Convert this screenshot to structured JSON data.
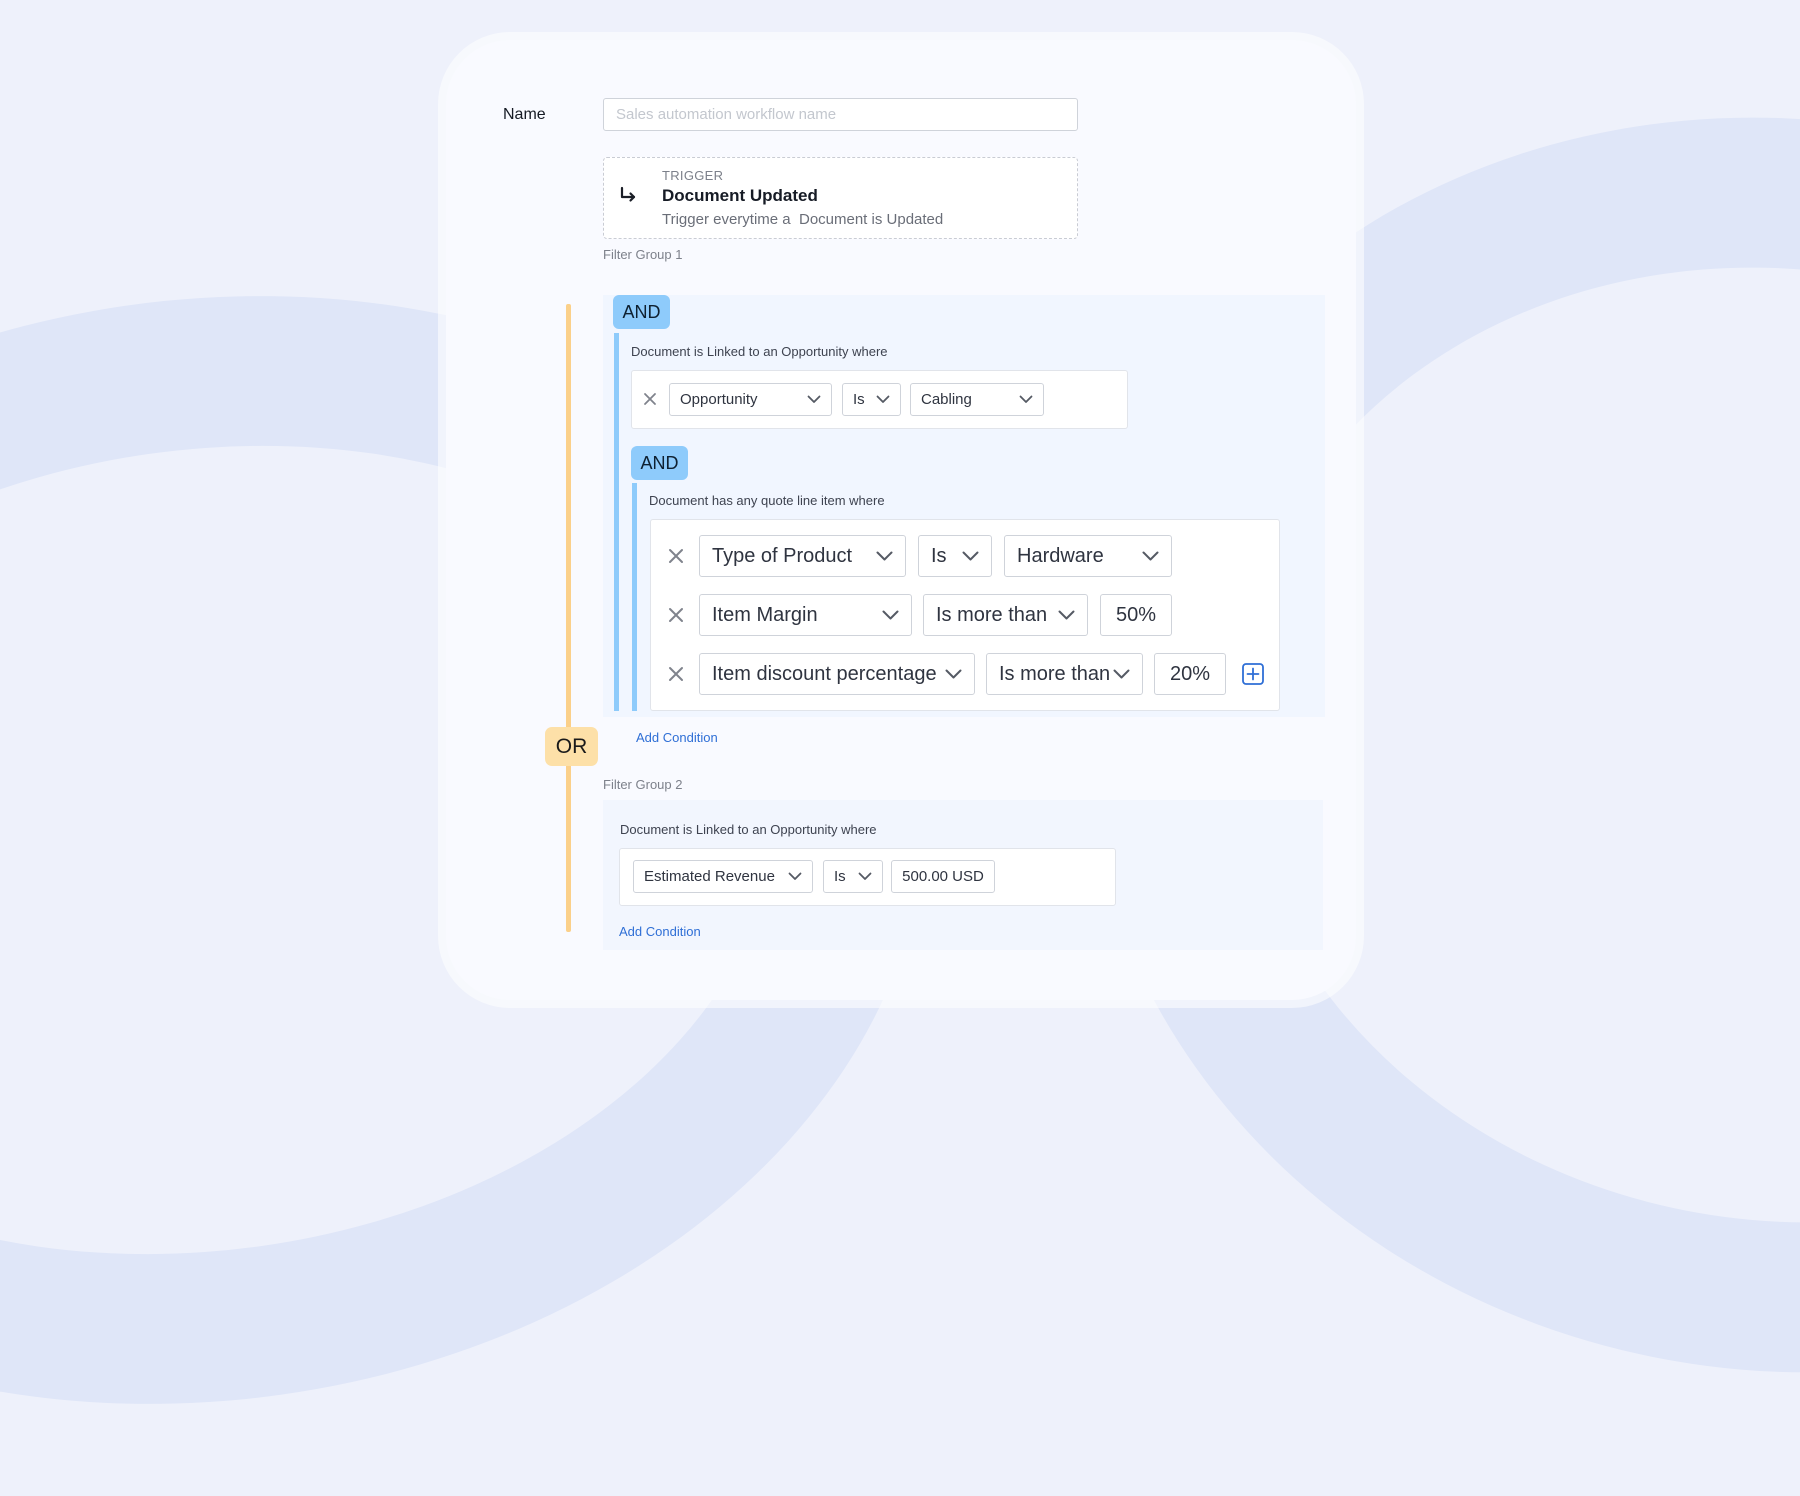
{
  "form": {
    "name_label": "Name",
    "name_placeholder": "Sales automation workflow name",
    "name_value": ""
  },
  "trigger": {
    "icon": "arrow-turn-down-right-icon",
    "kicker": "TRIGGER",
    "title": "Document Updated",
    "description": "Trigger everytime a  Document is Updated"
  },
  "or_label": "OR",
  "filter_group_1": {
    "label": "Filter Group 1",
    "and_label": "AND",
    "condition_text": "Document is Linked to an Opportunity where",
    "row": {
      "field": "Opportunity",
      "operator": "Is",
      "value": "Cabling"
    },
    "nested": {
      "and_label": "AND",
      "condition_text": "Document has any quote line item where",
      "rows": [
        {
          "field": "Type of Product",
          "operator": "Is",
          "value": "Hardware"
        },
        {
          "field": "Item Margin",
          "operator": "Is more than",
          "value": "50%"
        },
        {
          "field": "Item discount percentage",
          "operator": "Is more than",
          "value": "20%"
        }
      ]
    },
    "add_condition": "Add Condition"
  },
  "filter_group_2": {
    "label": "Filter Group 2",
    "condition_text": "Document is Linked to an Opportunity where",
    "row": {
      "field": "Estimated Revenue",
      "operator": "Is",
      "value": "500.00 USD"
    },
    "add_condition": "Add Condition"
  },
  "colors": {
    "and_badge": "#8ecbfb",
    "or_badge": "#fde0a8",
    "or_line": "#fbd08a",
    "link": "#2f6fd6"
  }
}
